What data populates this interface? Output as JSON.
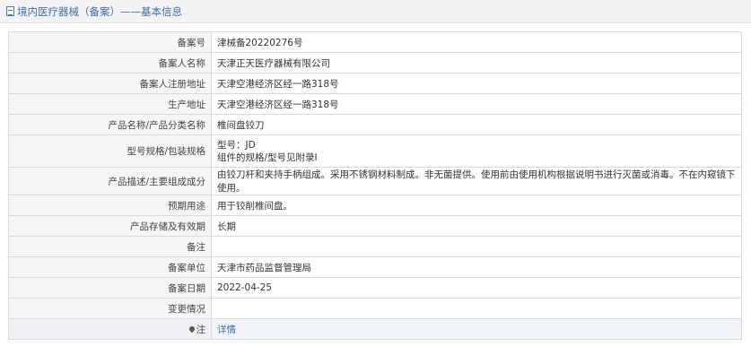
{
  "header": {
    "title": "境内医疗器械（备案）——基本信息"
  },
  "rows": [
    {
      "label": "备案号",
      "value": "津械备20220276号"
    },
    {
      "label": "备案人名称",
      "value": "天津正天医疗器械有限公司"
    },
    {
      "label": "备案人注册地址",
      "value": "天津空港经济区经一路318号"
    },
    {
      "label": "生产地址",
      "value": "天津空港经济区经一路318号"
    },
    {
      "label": "产品名称/产品分类名称",
      "value": "椎间盘铰刀"
    },
    {
      "label": "型号规格/包装规格",
      "value_line1": "型号：JD",
      "value_line2": "组件的规格/型号见附录I"
    },
    {
      "label": "产品描述/主要组成成分",
      "value": "由铰刀杆和夹持手柄组成。采用不锈钢材料制成。非无菌提供。使用前由使用机构根据说明书进行灭菌或消毒。不在内窥镜下使用。"
    },
    {
      "label": "预期用途",
      "value": "用于铰削椎间盘。"
    },
    {
      "label": "产品存储及有效期",
      "value": "长期"
    },
    {
      "label": "备注",
      "value": ""
    },
    {
      "label": "备案单位",
      "value": "天津市药品监督管理局"
    },
    {
      "label": "备案日期",
      "value": "2022-04-25"
    },
    {
      "label": "变更情况",
      "value": ""
    },
    {
      "label": "注",
      "value": "详情"
    }
  ],
  "icons": {
    "header_icon": "document-icon",
    "note_icon": "pin-icon"
  }
}
